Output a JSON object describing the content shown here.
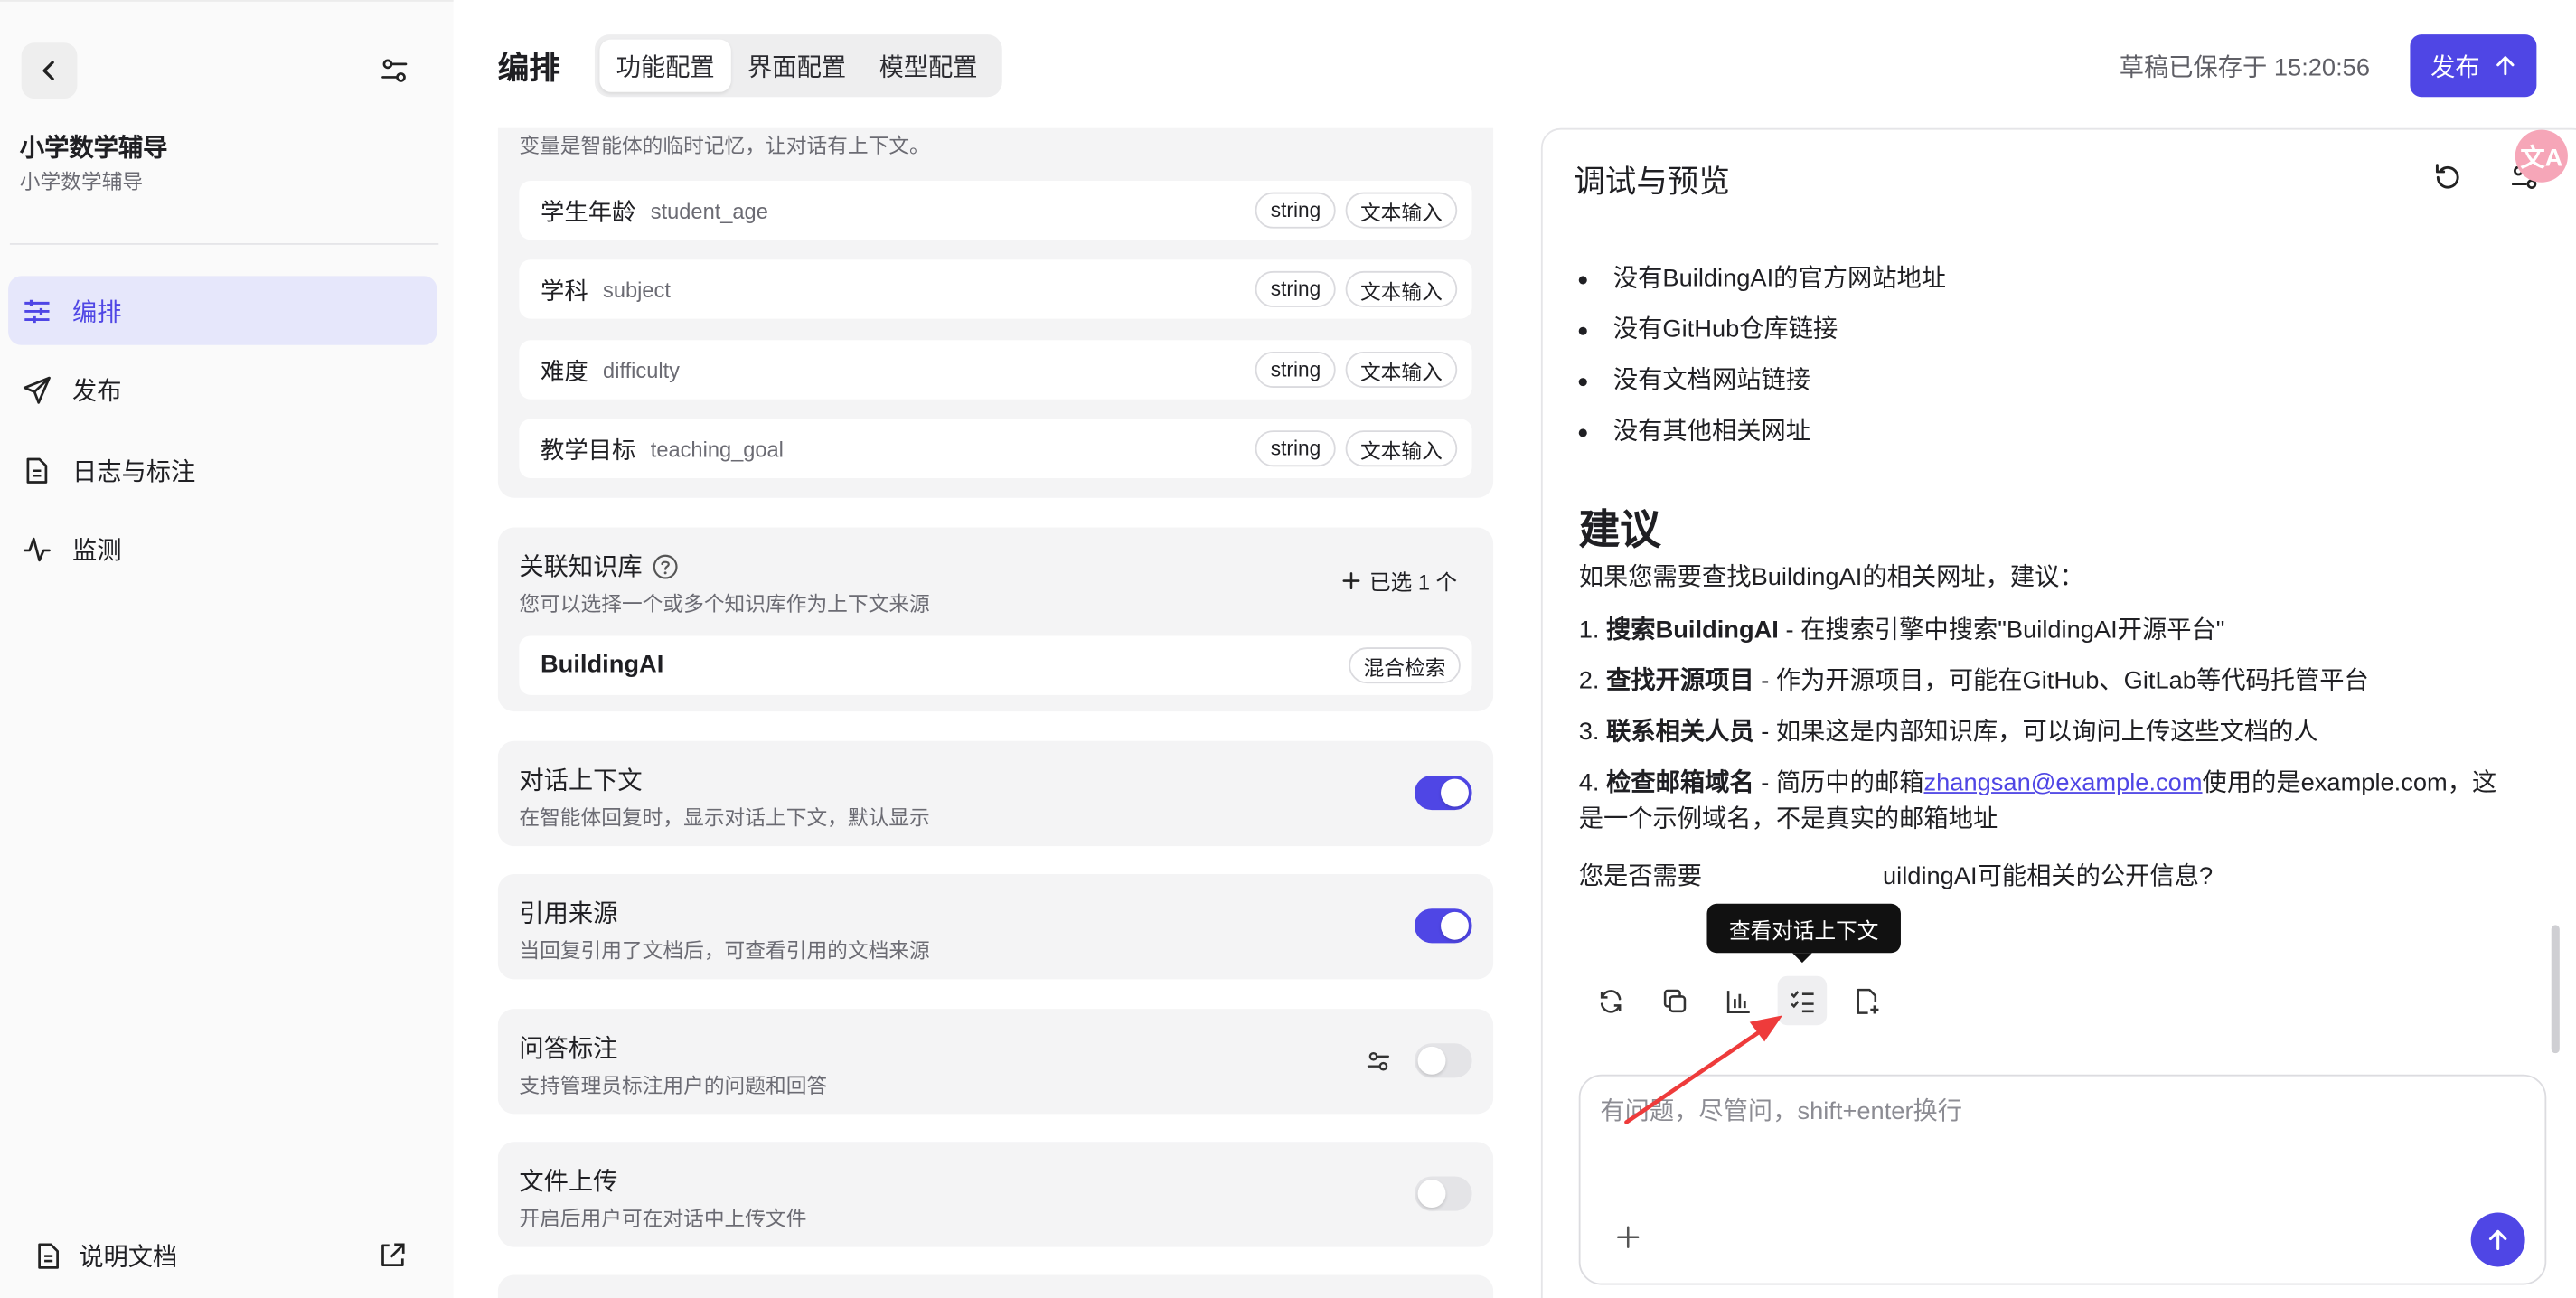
{
  "sidebar": {
    "app_name": "小学数学辅导",
    "app_desc": "小学数学辅导",
    "items": [
      {
        "label": "编排",
        "icon": "sliders-icon"
      },
      {
        "label": "发布",
        "icon": "send-icon"
      },
      {
        "label": "日志与标注",
        "icon": "document-icon"
      },
      {
        "label": "监测",
        "icon": "activity-icon"
      }
    ],
    "doc_link": "说明文档"
  },
  "header": {
    "title": "编排",
    "tabs": [
      "功能配置",
      "界面配置",
      "模型配置"
    ],
    "saved": "草稿已保存于 15:20:56",
    "publish": "发布"
  },
  "config": {
    "variables_hint": "变量是智能体的临时记忆，让对话有上下文。",
    "variables": [
      {
        "name": "学生年龄",
        "key": "student_age",
        "type": "string",
        "input": "文本输入"
      },
      {
        "name": "学科",
        "key": "subject",
        "type": "string",
        "input": "文本输入"
      },
      {
        "name": "难度",
        "key": "difficulty",
        "type": "string",
        "input": "文本输入"
      },
      {
        "name": "教学目标",
        "key": "teaching_goal",
        "type": "string",
        "input": "文本输入"
      }
    ],
    "knowledge": {
      "title": "关联知识库",
      "desc": "您可以选择一个或多个知识库作为上下文来源",
      "add": "已选 1 个",
      "item": "BuildingAI",
      "mode": "混合检索"
    },
    "toggles": [
      {
        "title": "对话上下文",
        "desc": "在智能体回复时，显示对话上下文，默认显示",
        "on": true
      },
      {
        "title": "引用来源",
        "desc": "当回复引用了文档后，可查看引用的文档来源",
        "on": true
      },
      {
        "title": "问答标注",
        "desc": "支持管理员标注用户的问题和回答",
        "on": false,
        "gear": true
      },
      {
        "title": "文件上传",
        "desc": "开启后用户可在对话中上传文件",
        "on": false
      }
    ]
  },
  "preview": {
    "title": "调试与预览",
    "bullets": [
      "没有BuildingAI的官方网站地址",
      "没有GitHub仓库链接",
      "没有文档网站链接",
      "没有其他相关网址"
    ],
    "heading": "建议",
    "intro": "如果您需要查找BuildingAI的相关网址，建议：",
    "steps": [
      {
        "n": "1. ",
        "b": "搜索BuildingAI",
        "t": " - 在搜索引擎中搜索\"BuildingAI开源平台\""
      },
      {
        "n": "2. ",
        "b": "查找开源项目",
        "t": " - 作为开源项目，可能在GitHub、GitLab等代码托管平台"
      },
      {
        "n": "3. ",
        "b": "联系相关人员",
        "t": " - 如果这是内部知识库，可以询问上传这些文档的人"
      }
    ],
    "step4": {
      "n": "4. ",
      "b": "检查邮箱域名",
      "t1": " - 简历中的邮箱",
      "email": "zhangsan@example.com",
      "t2": "使用的是example.com，这是一个示例域名，不是真实的邮箱地址"
    },
    "ask_a": "您是否需要",
    "ask_b": "uildingAI可能相关的公开信息?",
    "tooltip": "查看对话上下文",
    "input_placeholder": "有问题，尽管问，shift+enter换行",
    "translate_badge": "文A"
  }
}
